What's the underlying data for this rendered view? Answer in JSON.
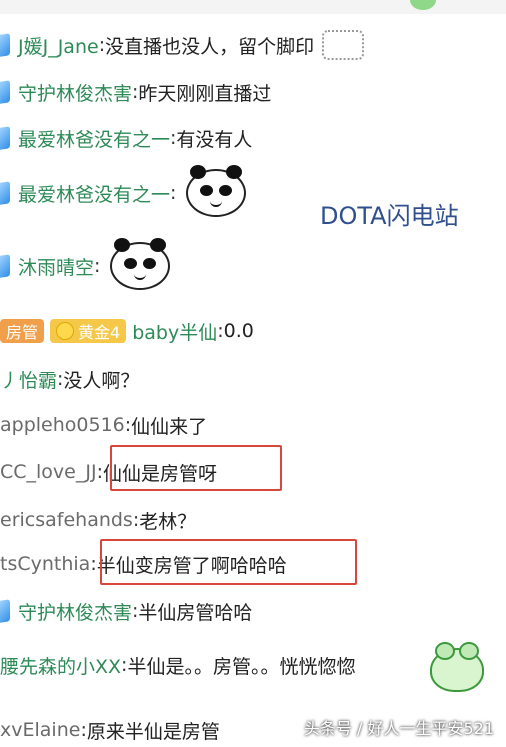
{
  "messages": [
    {
      "name": "J媛J_Jane",
      "sep": ": ",
      "text": "没直播也没人，留个脚印"
    },
    {
      "name": "守护林俊杰害",
      "sep": ": ",
      "text": "昨天刚刚直播过"
    },
    {
      "name": "最爱林爸没有之一",
      "sep": ": ",
      "text": "有没有人"
    },
    {
      "name": "最爱林爸没有之一",
      "sep": ": ",
      "text": ""
    },
    {
      "name": "沐雨晴空",
      "sep": ": ",
      "text": ""
    },
    {
      "badge1": "房管",
      "badge2": "黄金4",
      "name": "baby半仙",
      "sep": ": ",
      "text": "0.0"
    },
    {
      "name": "丿怡霸",
      "sep": ": ",
      "text": "没人啊？"
    },
    {
      "name": "appleho0516",
      "sep": ": ",
      "text": "仙仙来了"
    },
    {
      "name": "CC_love_JJ",
      "sep": ": ",
      "text": "仙仙是房管呀"
    },
    {
      "name": "ericsafehands",
      "sep": ": ",
      "text": "老林？"
    },
    {
      "name": "tsCynthia",
      "sep": ": ",
      "text": "半仙变房管了啊哈哈哈"
    },
    {
      "name": "守护林俊杰害",
      "sep": ": ",
      "text": "半仙房管哈哈"
    },
    {
      "name": "腰先森的小XX",
      "sep": ": ",
      "text": "半仙是。。房管。。恍恍惚惚"
    },
    {
      "name": "xvElaine",
      "sep": ": ",
      "text": "原来半仙是房管"
    }
  ],
  "watermark": "DOTA闪电站",
  "footer": "头条号 / 好人一生平安521",
  "colors": {
    "highlight": "#d9463b",
    "name": "#2e8b57"
  }
}
